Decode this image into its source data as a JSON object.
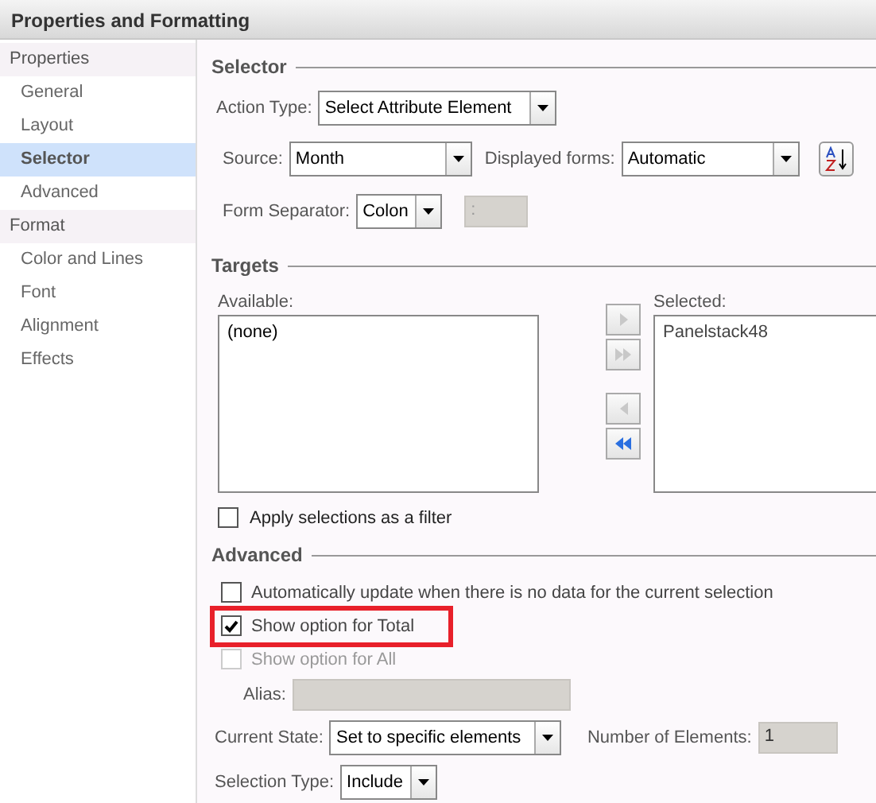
{
  "window": {
    "title": "Properties and Formatting"
  },
  "sidebar": {
    "groups": [
      {
        "label": "Properties",
        "items": [
          {
            "label": "General",
            "selected": false
          },
          {
            "label": "Layout",
            "selected": false
          },
          {
            "label": "Selector",
            "selected": true
          },
          {
            "label": "Advanced",
            "selected": false
          }
        ]
      },
      {
        "label": "Format",
        "items": [
          {
            "label": "Color and Lines",
            "selected": false
          },
          {
            "label": "Font",
            "selected": false
          },
          {
            "label": "Alignment",
            "selected": false
          },
          {
            "label": "Effects",
            "selected": false
          }
        ]
      }
    ]
  },
  "selector": {
    "title": "Selector",
    "action_type": {
      "label": "Action Type:",
      "value": "Select Attribute Element"
    },
    "source": {
      "label": "Source:",
      "value": "Month"
    },
    "displayed_forms": {
      "label": "Displayed forms:",
      "value": "Automatic"
    },
    "form_separator": {
      "label": "Form Separator:",
      "value": "Colon",
      "custom_value": ":"
    }
  },
  "targets": {
    "title": "Targets",
    "available": {
      "label": "Available:",
      "items": [
        "(none)"
      ]
    },
    "transfer_buttons": [
      {
        "kind": "right",
        "disabled": true
      },
      {
        "kind": "all-right",
        "disabled": true
      },
      {
        "kind": "left",
        "disabled": true
      },
      {
        "kind": "all-left",
        "disabled": false
      }
    ],
    "selected": {
      "label": "Selected:",
      "items": [
        "Panelstack48"
      ]
    },
    "apply_filter": {
      "label": "Apply selections as a filter",
      "checked": false
    }
  },
  "advanced": {
    "title": "Advanced",
    "options": [
      {
        "label": "Automatically update when there is no data for the current selection",
        "checked": false,
        "disabled": false,
        "highlighted": false
      },
      {
        "label": "Show option for Total",
        "checked": true,
        "disabled": false,
        "highlighted": true
      },
      {
        "label": "Show option for All",
        "checked": false,
        "disabled": true,
        "highlighted": false
      }
    ],
    "alias": {
      "label": "Alias:"
    },
    "current_state": {
      "label": "Current State:",
      "value": "Set to specific elements"
    },
    "number_of_elements": {
      "label": "Number of Elements:",
      "value": "1"
    },
    "selection_type": {
      "label": "Selection Type:",
      "value": "Include"
    }
  }
}
